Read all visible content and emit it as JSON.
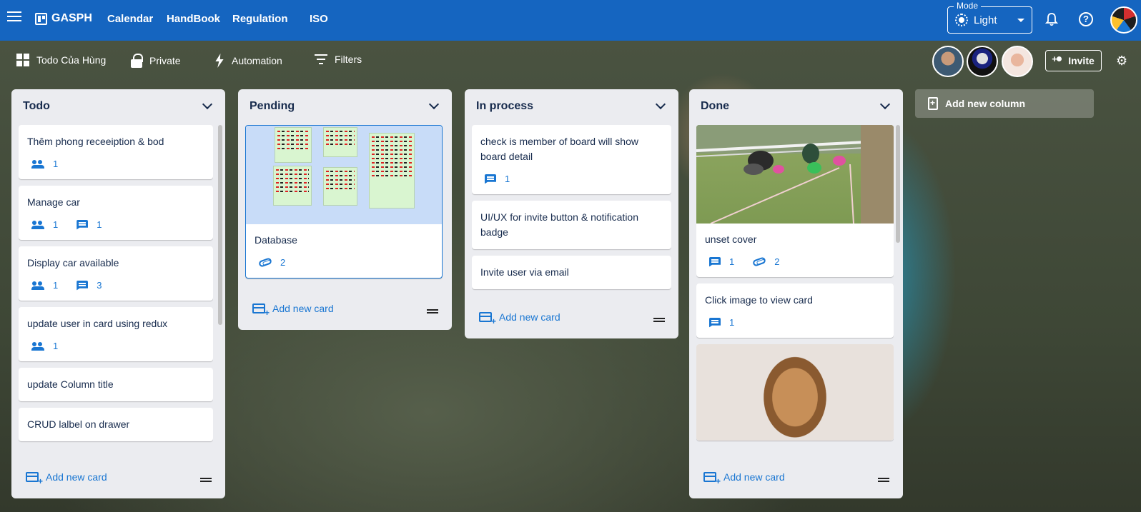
{
  "header": {
    "brand": "GASPH",
    "nav": [
      "Calendar",
      "HandBook",
      "Regulation",
      "ISO"
    ],
    "mode_label": "Mode",
    "mode_value": "Light"
  },
  "boardbar": {
    "board_name": "Todo Của Hùng",
    "visibility": "Private",
    "automation": "Automation",
    "filters": "Filters",
    "invite": "Invite"
  },
  "columns": [
    {
      "title": "Todo",
      "add_card": "Add new card",
      "cards": [
        {
          "title": "Thêm phong receeiption & bod",
          "members": "1"
        },
        {
          "title": "Manage car",
          "members": "1",
          "comments": "1"
        },
        {
          "title": "Display car available",
          "members": "1",
          "comments": "3"
        },
        {
          "title": "update user in card using redux",
          "members": "1"
        },
        {
          "title": "update Column title"
        },
        {
          "title": "CRUD lalbel on drawer"
        }
      ]
    },
    {
      "title": "Pending",
      "add_card": "Add new card",
      "cards": [
        {
          "title": "Database",
          "attachments": "2",
          "cover": "document"
        }
      ]
    },
    {
      "title": "In process",
      "add_card": "Add new card",
      "cards": [
        {
          "title": "check is member of board will show board detail",
          "comments": "1"
        },
        {
          "title": "UI/UX for invite button & notification badge"
        },
        {
          "title": "Invite user via email"
        }
      ]
    },
    {
      "title": "Done",
      "add_card": "Add new card",
      "cards": [
        {
          "title": "unset cover",
          "comments": "1",
          "attachments": "2",
          "cover": "photo-field"
        },
        {
          "title": "Click image to view card",
          "comments": "1"
        },
        {
          "cover": "photo-dog"
        }
      ]
    }
  ],
  "add_column": "Add new column",
  "colors": {
    "appbar": "#1565c0",
    "column_bg": "#ebecf0",
    "accent": "#1976d2"
  }
}
